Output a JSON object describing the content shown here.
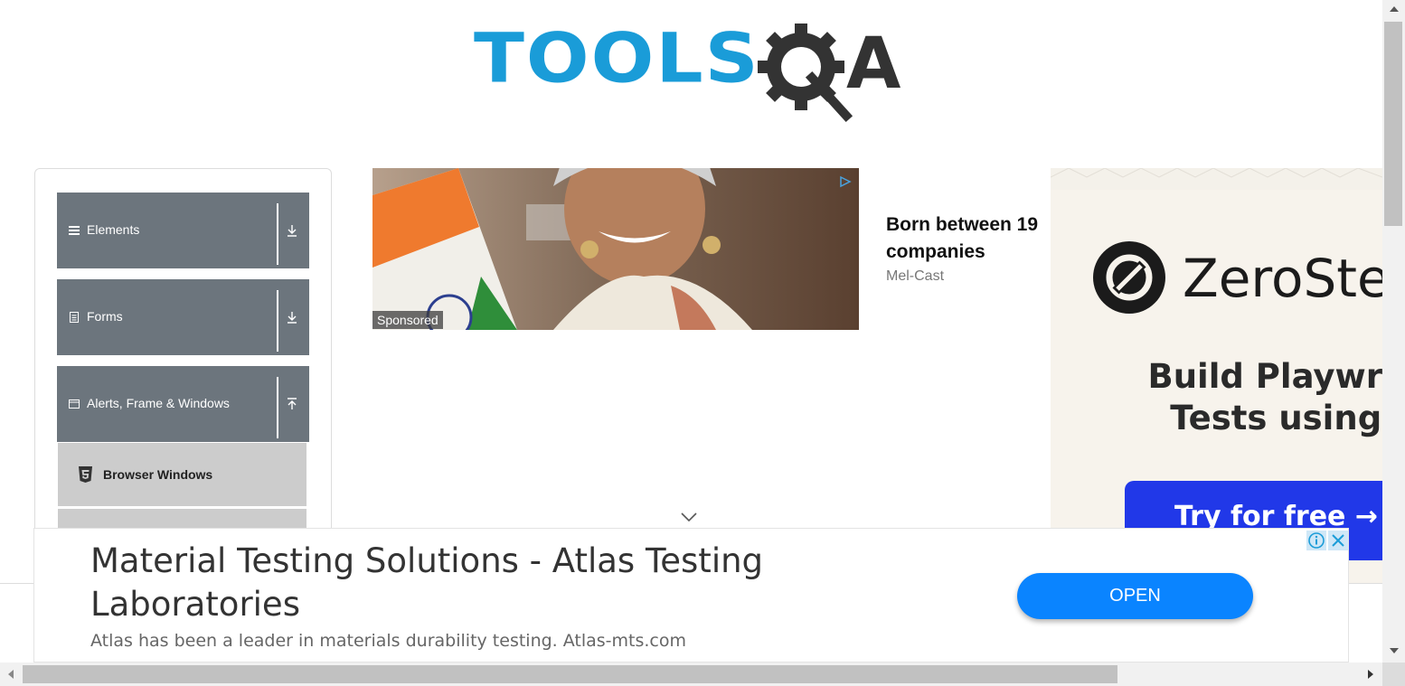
{
  "logo": {
    "text": "TOOLS",
    "suffix": "A",
    "brand_blue": "#1a9cd8",
    "brand_dark": "#333333"
  },
  "sidebar": {
    "groups": [
      {
        "label": "Elements",
        "icon": "menu-icon",
        "arrow": "arrow-down-icon"
      },
      {
        "label": "Forms",
        "icon": "form-icon",
        "arrow": "arrow-down-icon"
      },
      {
        "label": "Alerts, Frame & Windows",
        "icon": "window-icon",
        "arrow": "arrow-up-icon"
      }
    ],
    "sub_items": [
      {
        "label": "Browser Windows",
        "icon": "html5-icon"
      }
    ],
    "group_color": "#6c757d",
    "sub_color": "#cccccc"
  },
  "sponsored_ad": {
    "tag": "Sponsored",
    "headline": "Born between 19\ncompanies",
    "source": "Mel-Cast"
  },
  "right_ad": {
    "brand": "ZeroSte",
    "headline": "Build Playwrigh\nTests using A",
    "button": "Try for free →",
    "button_color": "#2138e8"
  },
  "bottom_ad": {
    "title": "Material Testing Solutions - Atlas Testing Laboratories",
    "description": "Atlas has been a leader in materials durability testing. Atlas-mts.com",
    "button": "OPEN",
    "button_color": "#0a84ff"
  }
}
